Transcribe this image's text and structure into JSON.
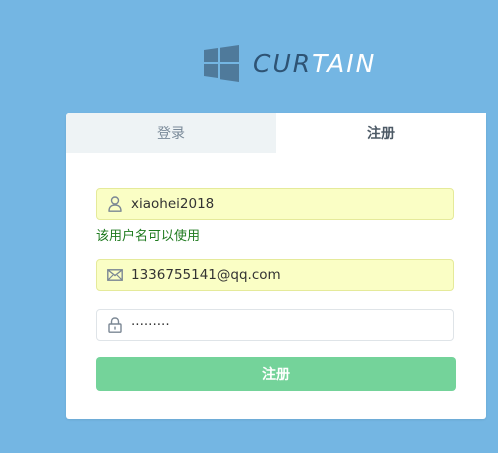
{
  "brand": {
    "text_a": "CUR",
    "text_b": "TAIN",
    "logo_icon": "windows-logo-icon"
  },
  "tabs": [
    {
      "label": "登录",
      "active": false
    },
    {
      "label": "注册",
      "active": true
    }
  ],
  "form": {
    "username": {
      "value": "xiaohei2018",
      "icon": "user-icon"
    },
    "username_hint": "该用户名可以使用",
    "email": {
      "value": "1336755141@qq.com",
      "icon": "mail-icon"
    },
    "password": {
      "value": "·········",
      "icon": "lock-icon"
    },
    "submit_label": "注册"
  },
  "colors": {
    "background": "#74b6e3",
    "autofill": "#fafec5",
    "success_text": "#1e7a1e",
    "submit": "#74d39a"
  }
}
